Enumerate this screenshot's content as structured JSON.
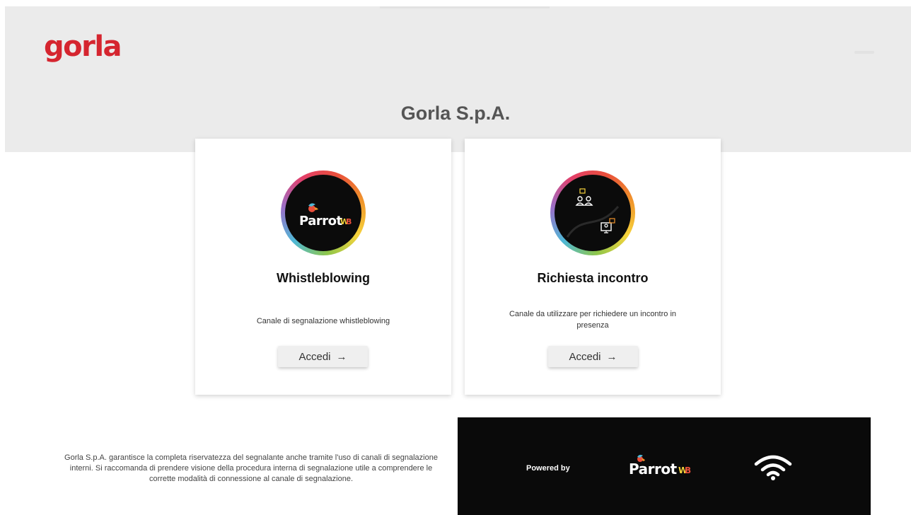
{
  "brand": {
    "logo_text": "gorla",
    "accent": "#d5252f"
  },
  "header": {
    "company_title": "Gorla S.p.A."
  },
  "cards": [
    {
      "title": "Whistleblowing",
      "description": "Canale di segnalazione whistleblowing",
      "button_label": "Accedi",
      "button_icon": "arrow-right-icon",
      "image": "parrot-wb-logo"
    },
    {
      "title": "Richiesta incontro",
      "description": "Canale da utilizzare per richiedere un incontro in presenza",
      "button_label": "Accedi",
      "button_icon": "arrow-right-icon",
      "image": "meeting-illustration"
    }
  ],
  "footer": {
    "notice": "Gorla S.p.A. garantisce la completa riservatezza del segnalante anche tramite l'uso di canali di segnalazione interni. Si raccomanda di prendere visione della procedura interna di segnalazione utile a comprendere le corrette modalità di connessione al canale di segnalazione.",
    "powered_by": "Powered by",
    "powered_logo_text": "Parrot WB",
    "icon": "wifi-icon"
  },
  "colors": {
    "hero_bg": "#ebebeb",
    "footer_dark": "#0a0a0a"
  }
}
